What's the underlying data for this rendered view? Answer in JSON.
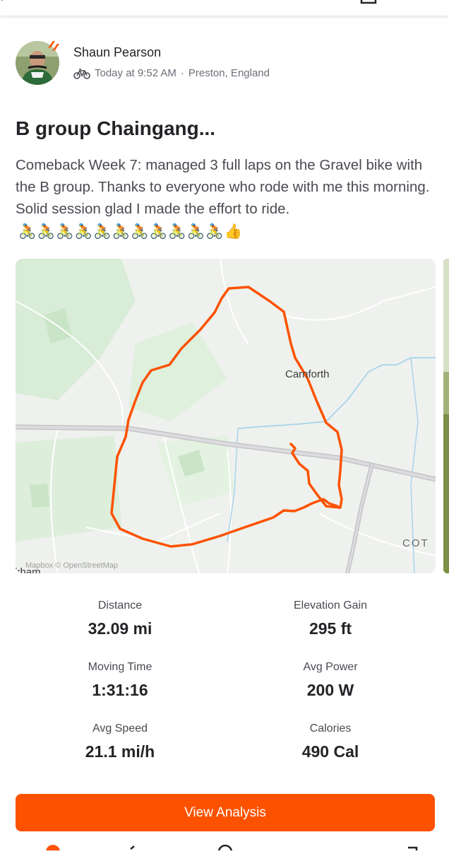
{
  "activity": {
    "athlete_name": "Shaun Pearson",
    "sport_icon": "bike-icon",
    "timestamp": "Today at 9:52 AM",
    "separator": "·",
    "location": "Preston, England",
    "title": "B group Chaingang...",
    "description": "Comeback Week 7:  managed 3 full laps on the Gravel bike with the B group.  Thanks to everyone who rode with me this morning.  Solid session glad I made the effort to ride.",
    "emojis": [
      "🚴",
      "🚴",
      "🚴",
      "🚴",
      "🚴",
      "🚴",
      "🚴",
      "🚴",
      "🚴",
      "🚴",
      "🚴",
      "👍"
    ]
  },
  "map": {
    "place_label": "Carnforth",
    "place_label_2": "COT",
    "place_label_3": "rkham",
    "attribution": "Mapbox © OpenStreetMap",
    "route_color": "#fc5200"
  },
  "stats": [
    {
      "label": "Distance",
      "value": "32.09 mi"
    },
    {
      "label": "Elevation Gain",
      "value": "295 ft"
    },
    {
      "label": "Moving Time",
      "value": "1:31:16"
    },
    {
      "label": "Avg Power",
      "value": "200 W"
    },
    {
      "label": "Avg Speed",
      "value": "21.1 mi/h"
    },
    {
      "label": "Calories",
      "value": "490 Cal"
    }
  ],
  "actions": {
    "view_analysis": "View Analysis"
  },
  "colors": {
    "brand": "#fc5200",
    "text_primary": "#242428",
    "text_secondary": "#6d6d78"
  }
}
